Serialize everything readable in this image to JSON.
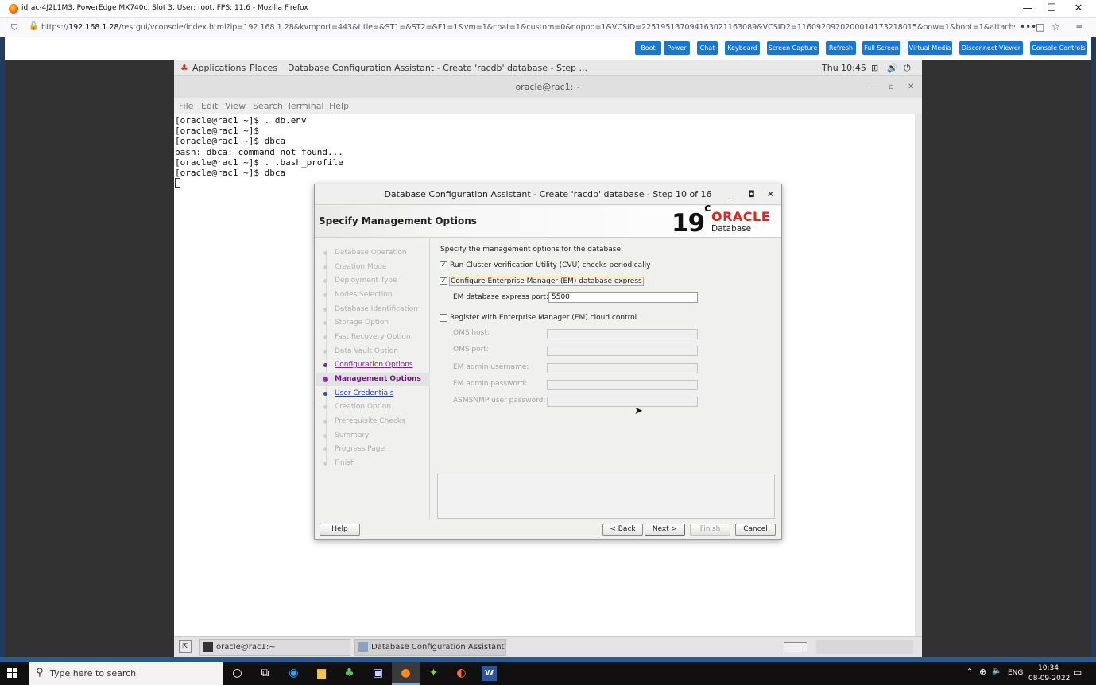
{
  "firefox": {
    "window_title": "idrac-4J2L1M3, PowerEdge MX740c, Slot 3, User: root, FPS: 11.6 - Mozilla Firefox",
    "url_prefix": "https://",
    "url_host": "192.168.1.28",
    "url_rest": "/restgui/vconsole/index.html?ip=192.168.1.28&kvmport=443&title=&ST1=&ST2=&F1=1&vm=1&chat=1&custom=0&nopop=1&VCSID=22519513709416302116308​9&VCSID2=1160920920200014173218015&pow=1&boot=1&attachstate=Auto-attach"
  },
  "idrac_toolbar": {
    "buttons": [
      "Boot",
      "Power",
      "Chat",
      "Keyboard",
      "Screen Capture",
      "Refresh",
      "Full Screen",
      "Virtual Media",
      "Disconnect Viewer",
      "Console Controls"
    ]
  },
  "gnome": {
    "applications": "Applications",
    "places": "Places",
    "active_window": "Database Configuration Assistant - Create 'racdb' database - Step ...",
    "clock": "Thu 10:45"
  },
  "terminal": {
    "title": "oracle@rac1:~",
    "menu": [
      "File",
      "Edit",
      "View",
      "Search",
      "Terminal",
      "Help"
    ],
    "lines": [
      "[oracle@rac1 ~]$ . db.env",
      "[oracle@rac1 ~]$",
      "[oracle@rac1 ~]$ dbca",
      "bash: dbca: command not found...",
      "[oracle@rac1 ~]$ . .bash_profile",
      "[oracle@rac1 ~]$ dbca"
    ]
  },
  "dbca": {
    "title": "Database Configuration Assistant - Create 'racdb' database - Step 10 of 16",
    "header": "Specify Management Options",
    "version_num": "19",
    "version_sup": "c",
    "brand": "ORACLE",
    "brand_sub": "Database",
    "steps": [
      "Database Operation",
      "Creation Mode",
      "Deployment Type",
      "Nodes Selection",
      "Database Identification",
      "Storage Option",
      "Fast Recovery Option",
      "Data Vault Option",
      "Configuration Options",
      "Management Options",
      "User Credentials",
      "Creation Option",
      "Prerequisite Checks",
      "Summary",
      "Progress Page",
      "Finish"
    ],
    "current_step": 10,
    "intro": "Specify the management options for the database.",
    "cvu_label": "Run Cluster Verification Utility (CVU) checks periodically",
    "cvu_checked": true,
    "em_label": "Configure Enterprise Manager (EM) database express",
    "em_checked": true,
    "em_port_label": "EM database express port:",
    "em_port_value": "5500",
    "cloud_label": "Register with Enterprise Manager (EM) cloud control",
    "cloud_checked": false,
    "oms_host_label": "OMS host:",
    "oms_port_label": "OMS port:",
    "em_admin_user_label": "EM admin username:",
    "em_admin_pass_label": "EM admin password:",
    "asmsnmp_label": "ASMSNMP user password:",
    "help_btn": "Help",
    "back_btn": "< Back",
    "next_btn": "Next >",
    "finish_btn": "Finish",
    "cancel_btn": "Cancel"
  },
  "gnome_taskbar": {
    "item1": "oracle@rac1:~",
    "item2": "Database Configuration Assistant - C..."
  },
  "windows": {
    "search_placeholder": "Type here to search",
    "lang": "ENG",
    "time": "10:34",
    "date": "08-09-2022"
  },
  "colors": {
    "idrac_button": "#1877d2",
    "oracle_red": "#e2231a",
    "step_done": "#7a2a8a",
    "step_next": "#1f3f9f"
  }
}
